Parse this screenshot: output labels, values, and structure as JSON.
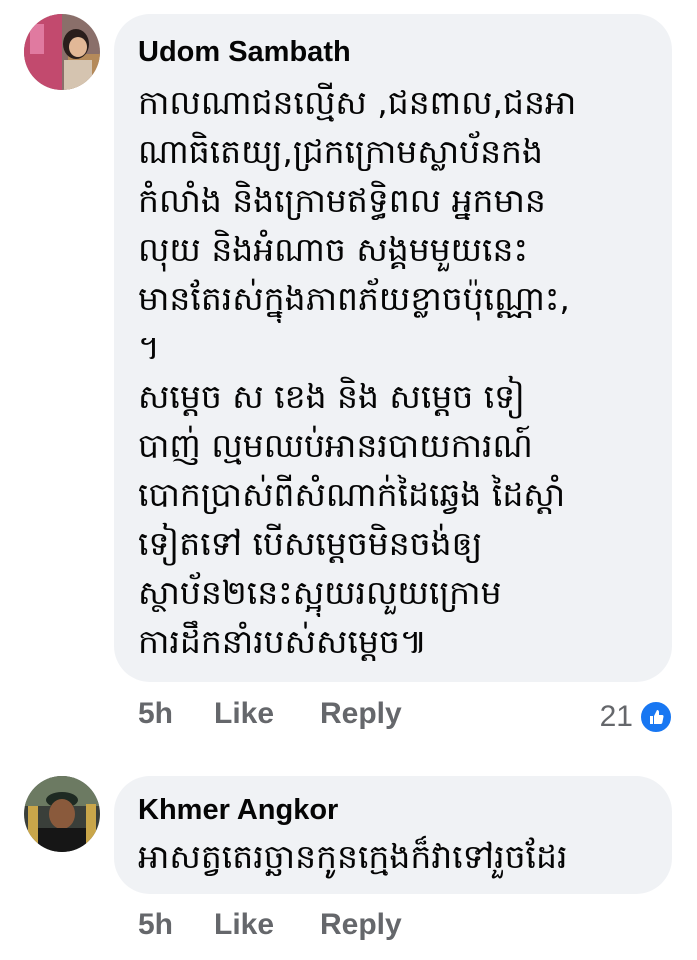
{
  "comments": [
    {
      "author": "Udom Sambath",
      "lines": [
        "កាលណាជនល្មើស ,ជនពាល,ជនអា",
        "ណាធិតេយ្យ,ជ្រកក្រោមស្លាប័នកង",
        "កំលាំង និងក្រោមឥទ្ធិពល អ្នកមាន",
        "លុយ និងអំណាច សង្គមមួយនេះ",
        "មានតែរស់ក្នុងភាពភ័យខ្លាចប៉ុណ្ណោះ,",
        "។",
        "សម្តេច ស ខេង និង សម្តេច ទៀ",
        "បាញ់ ល្មមឈប់អានរបាយការណ៍",
        "បោកប្រាស់ពីសំណាក់ដៃឆ្វេង ដៃស្តាំ",
        "ទៀតទៅ បើសម្តេចមិនចង់ឲ្យ",
        "ស្ថាប័ន២នេះស្អុយរលួយក្រោម",
        "ការដឹកនាំរបស់សម្តេច៕"
      ],
      "time": "5h",
      "like_label": "Like",
      "reply_label": "Reply",
      "reaction_count": "21",
      "reaction_icon": "like-icon"
    },
    {
      "author": "Khmer Angkor",
      "lines": [
        "អាសត្វតេរច្ឆានកូនក្មេងក៏វាទៅរួចដែរ"
      ],
      "time": "5h",
      "like_label": "Like",
      "reply_label": "Reply"
    }
  ],
  "colors": {
    "bubble": "#f0f2f5",
    "meta": "#65676b",
    "like_blue": "#1877f2"
  }
}
